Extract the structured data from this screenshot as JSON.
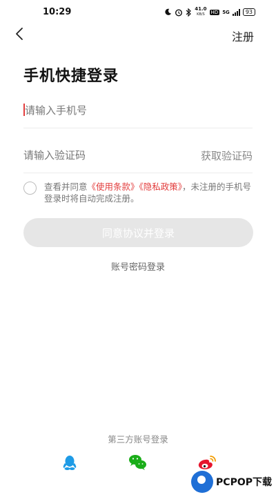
{
  "status_bar": {
    "time": "10:29",
    "speed_value": "41.0",
    "speed_unit": "KB/S",
    "hd_badge": "HD",
    "network": "5G",
    "battery": "93"
  },
  "nav": {
    "back_icon": "chevron-left-icon",
    "register_label": "注册"
  },
  "title": "手机快捷登录",
  "phone_field": {
    "placeholder": "请输入手机号",
    "value": ""
  },
  "code_field": {
    "placeholder": "请输入验证码",
    "value": "",
    "get_code_label": "获取验证码"
  },
  "agreement": {
    "checked": false,
    "prefix": "查看并同意",
    "terms_link": "《使用条款》",
    "privacy_link": "《隐私政策》",
    "suffix": "，未注册的手机号登录时将自动完成注册。"
  },
  "login_button": {
    "label": "同意协议并登录"
  },
  "password_login_label": "账号密码登录",
  "third_party": {
    "title": "第三方账号登录",
    "icons": [
      "qq-icon",
      "wechat-icon",
      "weibo-icon"
    ]
  },
  "watermark": {
    "text": "PCPOP下载"
  },
  "colors": {
    "accent_red": "#e23c3c",
    "qq_blue": "#1e9be6",
    "wechat_green": "#1aad19",
    "weibo_red": "#e6162d",
    "disabled_button": "#e6e6e6"
  }
}
